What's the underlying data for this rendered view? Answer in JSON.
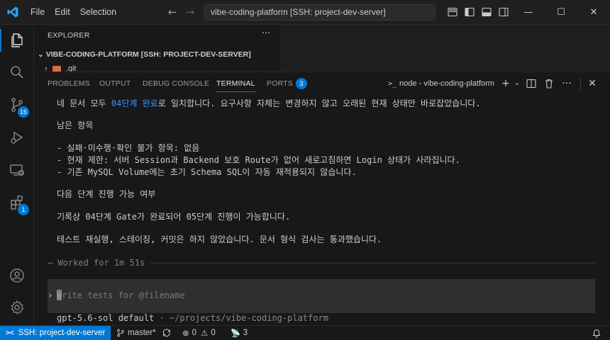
{
  "menu": [
    "File",
    "Edit",
    "Selection"
  ],
  "search": {
    "text": "vibe-coding-platform [SSH: project-dev-server]"
  },
  "activity": {
    "scm_badge": "16",
    "extensions_badge": "1"
  },
  "sidebar": {
    "title": "EXPLORER",
    "more": "···",
    "root": "VIBE-CODING-PLATFORM [SSH: PROJECT-DEV-SERVER]",
    "item": ".git"
  },
  "panel": {
    "tabs": [
      "PROBLEMS",
      "OUTPUT",
      "DEBUG CONSOLE",
      "TERMINAL",
      "PORTS"
    ],
    "ports_badge": "3",
    "terminal_name": "node - vibe-coding-platform"
  },
  "terminal": {
    "line1_pre": "네 문서 모두 ",
    "line1_hl": "04단계 완료",
    "line1_post": "로 일치합니다. 요구사항 자체는 변경하지 않고 오래된 현재 상태만 바로잡았습니다.",
    "heading_remaining": "남은 항목",
    "bullet1": "- 실패·미수행·확인 불가 항목: 없음",
    "bullet2": "- 현재 제한: 서버 Session과 Backend 보호 Route가 없어 새로고침하면 Login 상태가 사라집니다.",
    "bullet3": "- 기존 MySQL Volume에는 초기 Schema SQL이 자동 재적용되지 않습니다.",
    "heading_next": "다음 단계 진행 가능 여부",
    "next_line": "기록상 04단계 Gate가 완료되어 05단계 진행이 가능합니다.",
    "summary_line": "테스트 재실행, 스테이징, 커밋은 하지 않았습니다. 문서 형식 검사는 통과했습니다.",
    "worked": "— Worked for 1m 51s",
    "prompt_caret": "›",
    "input_placeholder": "Write tests for @filename",
    "model": "gpt-5.6-sol default",
    "model_sep": " · ",
    "model_path": "~/projects/vibe-coding-platform"
  },
  "status": {
    "remote": "SSH: project-dev-server",
    "branch": "master*",
    "errors": "0",
    "warnings": "0",
    "ports": "3"
  },
  "colors": {
    "accent": "#0078d4",
    "highlight": "#3794ff"
  }
}
